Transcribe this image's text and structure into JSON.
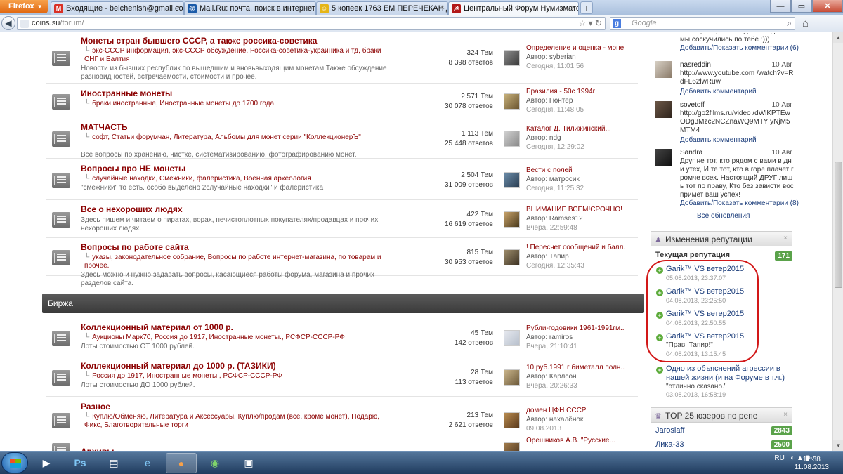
{
  "browser": {
    "menu_label": "Firefox",
    "tabs": [
      {
        "label": "Входящие - belchenish@gmail.com ...",
        "favicon": "gmail-icon",
        "color": "#d93025",
        "glyph": "M"
      },
      {
        "label": "Mail.Ru: почта, поиск в интернете, н...",
        "favicon": "mailru-icon",
        "color": "#1a5aa8",
        "glyph": "@"
      },
      {
        "label": "5 копеек 1763 ЕМ ПЕРЕЧЕКАН до 11....",
        "favicon": "smiley-icon",
        "color": "#e5b517",
        "glyph": "☺"
      },
      {
        "label": "Центральный Форум Нумизматов ...",
        "favicon": "coins-icon",
        "color": "#b21818",
        "glyph": "☭"
      }
    ],
    "new_tab": "+",
    "url_host": "coins.su",
    "url_path": "/forum/",
    "search_placeholder": "Google",
    "search_g": "g"
  },
  "forums": [
    {
      "title": "Монеты стран бывшего СССР, а также россика-советика",
      "subs": "экс-СССР информация,  экс-СССР обсуждение,  Россика-советика-украиника и тд,  браки СНГ и Балтия",
      "desc": "Новости из бывших республик по вышедшим и вновьвыходящим монетам.Также обсуждение разновидностей, встречаемости, стоимости и прочее.",
      "topics": "324 Тем",
      "posts": "8 398 ответов",
      "last_title": "Определение и оценка - моне...",
      "last_author": "Автор: syberian",
      "last_time": "Сегодня, 11:01:56"
    },
    {
      "title": "Иностранные монеты",
      "subs": "браки иностранные,  Иностранные монеты до 1700 года",
      "desc": "",
      "topics": "2 571 Тем",
      "posts": "30 078 ответов",
      "last_title": "Бразилия - 50с 1994г",
      "last_author": "Автор: Гюнтер",
      "last_time": "Сегодня, 11:48:05"
    },
    {
      "title": "МАТЧАСТЬ",
      "subs": "софт,  Статьи форумчан,  Литература,  Альбомы для монет серии \"КоллекционерЪ\"",
      "desc": "Все вопросы по хранению, чистке, систематизированию, фотографированию монет.",
      "topics": "1 113 Тем",
      "posts": "25 448 ответов",
      "last_title": "Каталог Д. Тилижинский...",
      "last_author": "Автор: ndg",
      "last_time": "Сегодня, 12:29:02"
    },
    {
      "title": "Вопросы про НЕ монеты",
      "subs": "случайные находки,  Смежники,  фалеристика,  Военная археология",
      "desc": "\"смежники\" то есть. особо выделено 2случайные находки\" и фалеристика",
      "topics": "2 504 Тем",
      "posts": "31 009 ответов",
      "last_title": "Вести с полей",
      "last_author": "Автор: матросик",
      "last_time": "Сегодня, 11:25:32"
    },
    {
      "title": "Все о нехороших людях",
      "subs": "",
      "desc": "Здесь пишем и читаем о пиратах, ворах, нечистоплотных покупателях/продавцах и прочих нехороших людях.",
      "topics": "422 Тем",
      "posts": "16 619 ответов",
      "last_title": "ВНИМАНИЕ ВСЕМ!СРОЧНО!",
      "last_author": "Автор: Ramses12",
      "last_time": "Вчера, 22:59:48"
    },
    {
      "title": "Вопросы по работе сайта",
      "subs": "указы,  законодательное собрание,  Вопросы по работе интернет-магазина, по товарам и прочее.",
      "desc": "Здесь можно и нужно задавать вопросы, касающиеся работы форума, магазина и прочих разделов сайта.",
      "topics": "815 Тем",
      "posts": "30 953 ответов",
      "last_title": "! Пересчет сообщений и балл...",
      "last_author": "Автор: Тапир",
      "last_time": "Сегодня, 12:35:43"
    }
  ],
  "category": "Биржа",
  "forums2": [
    {
      "title": "Коллекционный материал от 1000 р.",
      "subs": "Аукционы Марк70,  Россия до 1917,  Иностранные монеты.,  РСФСР-СССР-РФ",
      "desc": "Лоты стоимостью ОТ 1000 рублей.",
      "topics": "45 Тем",
      "posts": "142 ответов",
      "last_title": "Рубли-годовики 1961-1991гм...",
      "last_author": "Автор: ramiros",
      "last_time": "Вчера, 21:10:41"
    },
    {
      "title": "Коллекционный материал до 1000 р. (ТАЗИКИ)",
      "subs": "Россия до 1917,  Иностранные монеты.,  РСФСР-СССР-РФ",
      "desc": "Лоты стоимостью ДО 1000 рублей.",
      "topics": "28 Тем",
      "posts": "113 ответов",
      "last_title": "10 руб.1991 г биметалл полн...",
      "last_author": "Автор: Карлсон",
      "last_time": "Вчера, 20:26:33"
    },
    {
      "title": "Разное",
      "subs": "Куплю/Обменяю,  Литература и Аксессуары,  Куплю/продам (всё, кроме монет),  Подарю,  Фикс,  Благотворительные торги",
      "desc": "",
      "topics": "213 Тем",
      "posts": "2 621 ответов",
      "last_title": "домен ЦФН СССР",
      "last_author": "Автор: нахалёнок",
      "last_time": "09.08.2013"
    },
    {
      "title": "Архивы",
      "subs": "",
      "desc": "",
      "topics": "",
      "posts": "",
      "last_title": "Орешников А.В. \"Русские...",
      "last_author": "",
      "last_time": ""
    }
  ],
  "sidebar": {
    "top_snippet": "важно, ликуся выходи из-подполья мы соскучились по тебе :)))",
    "top_link": "Добавить/Показать комментарии (6)",
    "comments": [
      {
        "name": "nasreddin",
        "date": "10 Авг",
        "text": "http://www.youtube.com /watch?v=RdFL62lwRuw",
        "link": "Добавить комментарий"
      },
      {
        "name": "sovetoff",
        "date": "10 Авг",
        "text": "http://go2films.ru/video /dWlKPTEwODg3Mzc2NCZnaWQ9MTY yNjM5MTM4",
        "link": "Добавить комментарий"
      },
      {
        "name": "Sandra",
        "date": "10 Авг",
        "text": "Друг не тот, кто рядом с вами в дни утех, И те тот, кто в горе плачет громче всех. Настоящий ДРУГ лишь тот по праву, Кто без зависти воспримет ваш успех!",
        "link": "Добавить/Показать комментарии (8)"
      }
    ],
    "all_updates": "Все обновления",
    "rep_widget_title": "Изменения репутации",
    "current_rep_label": "Текущая репутация",
    "current_rep_value": "171",
    "rep_items": [
      {
        "who": "Garik™ VS ветер2015",
        "quote": "",
        "date": "05.08.2013, 23:37:07"
      },
      {
        "who": "Garik™ VS ветер2015",
        "quote": "",
        "date": "04.08.2013, 23:25:50"
      },
      {
        "who": "Garik™ VS ветер2015",
        "quote": "",
        "date": "04.08.2013, 22:50:55"
      },
      {
        "who": "Garik™ VS ветер2015",
        "quote": "\"Прав, Тапир!\"",
        "date": "04.08.2013, 13:15:45"
      }
    ],
    "rep_extra": {
      "text": "Одно из объяснений агрессии в нашей жизни (и на Форуме в т.ч.)",
      "quote": "\"отлично сказано.\"",
      "date": "03.08.2013, 16:58:19"
    },
    "top_widget_title": "TOP 25 юзеров по репе",
    "top_users": [
      {
        "name": "Jaroslaff",
        "value": "2843"
      },
      {
        "name": "Лика-33",
        "value": "2500"
      }
    ]
  },
  "taskbar": {
    "lang": "RU",
    "time": "12:38",
    "date": "11.08.2013"
  }
}
